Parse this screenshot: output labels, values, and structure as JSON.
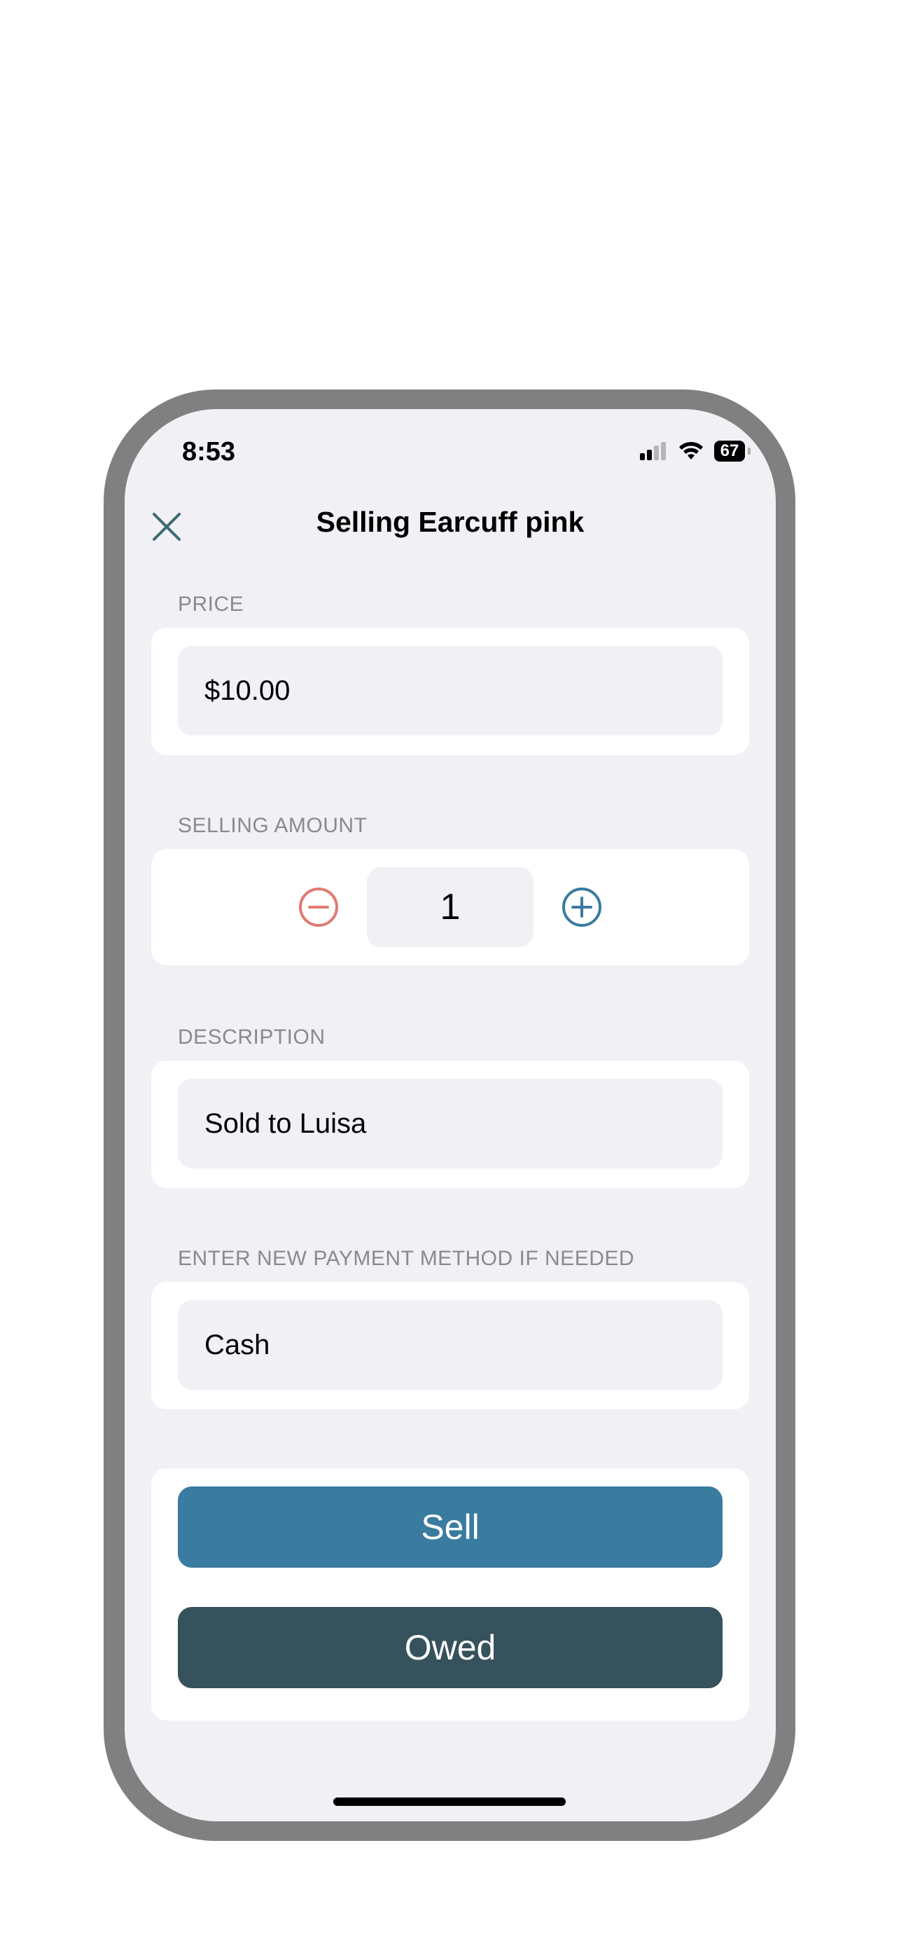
{
  "status_bar": {
    "time": "8:53",
    "battery": "67"
  },
  "header": {
    "title": "Selling Earcuff pink"
  },
  "price": {
    "label": "PRICE",
    "value": "$10.00"
  },
  "selling_amount": {
    "label": "SELLING AMOUNT",
    "value": "1"
  },
  "description": {
    "label": "DESCRIPTION",
    "value": "Sold to Luisa"
  },
  "payment": {
    "label": "ENTER NEW PAYMENT METHOD IF NEEDED",
    "value": "Cash"
  },
  "actions": {
    "sell_label": "Sell",
    "owed_label": "Owed"
  },
  "colors": {
    "sell": "#3a7ba0",
    "owed": "#36525c",
    "decrement": "#e07a72",
    "increment": "#3a7ba0",
    "close": "#3d6b72"
  },
  "icons": {
    "close": "close-icon",
    "decrement": "minus-circle-icon",
    "increment": "plus-circle-icon",
    "signal": "cellular-signal-icon",
    "wifi": "wifi-icon",
    "battery": "battery-icon"
  }
}
